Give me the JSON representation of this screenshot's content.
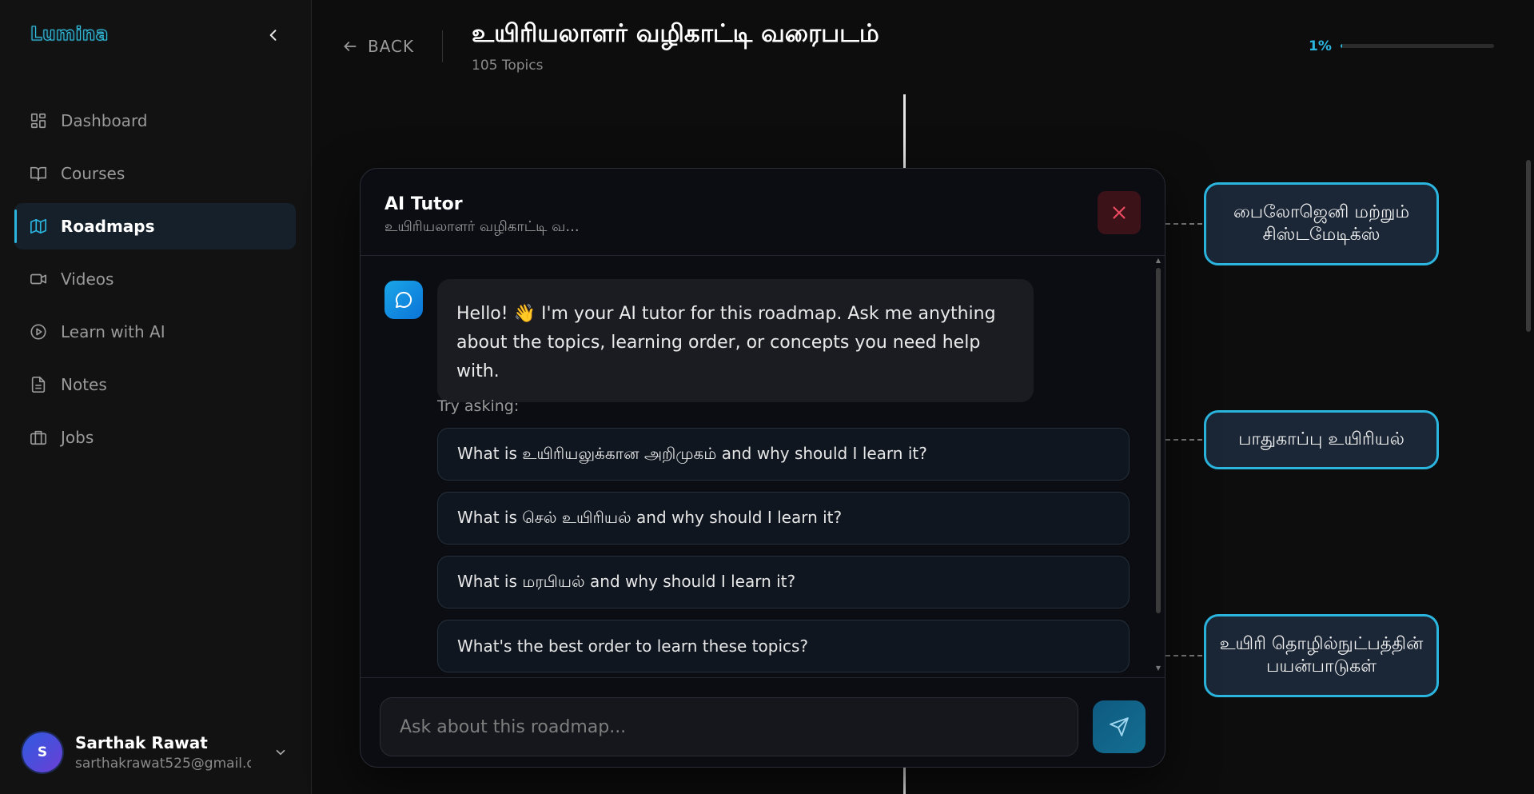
{
  "app": {
    "logo": "Lumina"
  },
  "sidebar": {
    "items": [
      {
        "label": "Dashboard",
        "icon": "dashboard-icon",
        "active": false
      },
      {
        "label": "Courses",
        "icon": "book-icon",
        "active": false
      },
      {
        "label": "Roadmaps",
        "icon": "map-icon",
        "active": true
      },
      {
        "label": "Videos",
        "icon": "video-icon",
        "active": false
      },
      {
        "label": "Learn with AI",
        "icon": "play-circle-icon",
        "active": false
      },
      {
        "label": "Notes",
        "icon": "document-icon",
        "active": false
      },
      {
        "label": "Jobs",
        "icon": "briefcase-icon",
        "active": false
      }
    ],
    "user": {
      "initial": "S",
      "name": "Sarthak Rawat",
      "email": "sarthakrawat525@gmail.c..."
    }
  },
  "header": {
    "back_label": "BACK",
    "title": "உயிரியலாளர் வழிகாட்டி வரைபடம்",
    "subtitle": "105 Topics",
    "progress_label": "1%",
    "progress_fraction": 0.01
  },
  "roadmap": {
    "nodes": [
      {
        "label": "பைலோஜெனி மற்றும் சிஸ்டமேடிக்ஸ்"
      },
      {
        "label": "பாதுகாப்பு உயிரியல்"
      },
      {
        "label": "உயிரி தொழில்நுட்பத்தின் பயன்பாடுகள்"
      }
    ]
  },
  "tutor": {
    "title": "AI Tutor",
    "subtitle": "உயிரியலாளர் வழிகாட்டி வ...",
    "greeting": "Hello! 👋 I'm your AI tutor for this roadmap. Ask me anything about the topics, learning order, or concepts you need help with.",
    "try_label": "Try asking:",
    "suggestions": [
      "What is உயிரியலுக்கான அறிமுகம் and why should I learn it?",
      "What is செல் உயிரியல் and why should I learn it?",
      "What is மரபியல் and why should I learn it?",
      "What's the best order to learn these topics?"
    ],
    "input_placeholder": "Ask about this roadmap..."
  },
  "colors": {
    "accent": "#2bb6e0",
    "node_fill": "#1b2736",
    "close_bg": "#3a1218",
    "close_icon": "#e84a5f"
  }
}
